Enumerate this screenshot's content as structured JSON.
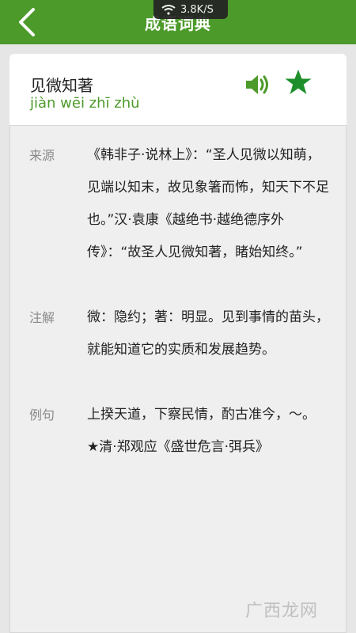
{
  "header": {
    "title": "成语词典",
    "network_speed": "3.8K/S",
    "icons": [
      "wifi-icon",
      "back-icon"
    ]
  },
  "entry": {
    "idiom": "见微知著",
    "pinyin": "jiàn wēi zhī zhù",
    "actions": [
      "speaker-icon",
      "favorite-star-icon"
    ],
    "accent_color": "#4c9a2a"
  },
  "sections": [
    {
      "label": "来源",
      "text": "《韩非子·说林上》：“圣人见微以知萌，见端以知末，故见象箸而怖，知天下不足也。”汉·袁康《越绝书·越绝德序外传》：“故圣人见微知著，睹始知终。”"
    },
    {
      "label": "注解",
      "text": "微：隐约；著：明显。见到事情的苗头，就能知道它的实质和发展趋势。"
    },
    {
      "label": "例句",
      "text": "上揆天道，下察民情，酌古准今，～。 ★清·郑观应《盛世危言·弭兵》"
    }
  ],
  "watermark": "广西龙网"
}
